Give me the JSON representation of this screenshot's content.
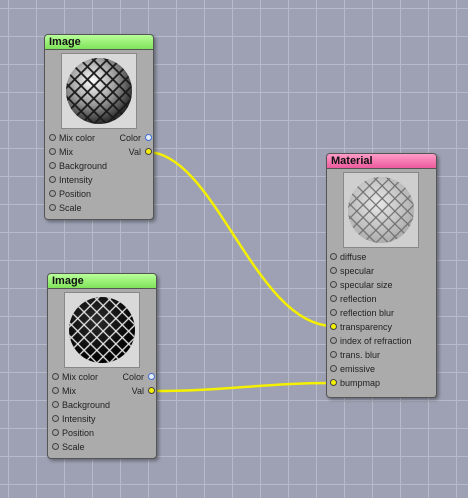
{
  "nodes": [
    {
      "title": "Image",
      "inputs": [
        "Mix color",
        "Mix",
        "Background",
        "Intensity",
        "Position",
        "Scale"
      ],
      "outputs": [
        "Color",
        "Val"
      ]
    },
    {
      "title": "Image",
      "inputs": [
        "Mix color",
        "Mix",
        "Background",
        "Intensity",
        "Position",
        "Scale"
      ],
      "outputs": [
        "Color",
        "Val"
      ]
    },
    {
      "title": "Material",
      "inputs": [
        "diffuse",
        "specular",
        "specular size",
        "reflection",
        "reflection blur",
        "transparency",
        "index of refraction",
        "trans. blur",
        "emissive",
        "bumpmap"
      ]
    }
  ],
  "colors": {
    "background": "#9da1b3",
    "grid": "#b7bac8",
    "image_header": "#8ff06a",
    "material_header": "#f06aa8",
    "wire": "#f4f000",
    "color_socket": "#3f6ed8",
    "value_socket": "#f4f000"
  },
  "icons": [
    "mesh-sphere-preview-icon",
    "dark-mesh-sphere-preview-icon",
    "material-sphere-preview-icon"
  ]
}
